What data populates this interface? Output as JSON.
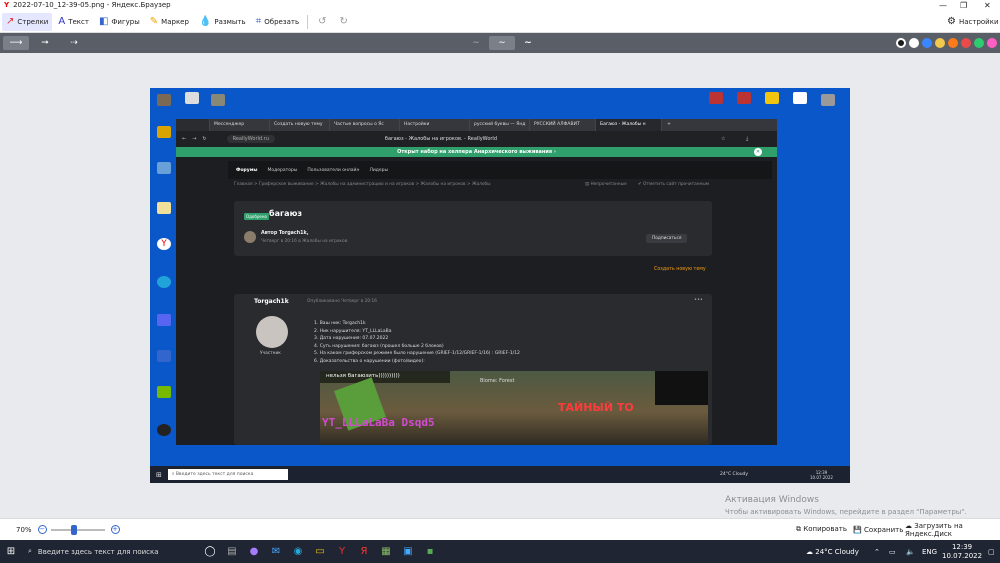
{
  "title": "2022-07-10_12-39-05.png - Яндекс.Браузер",
  "toolbar": {
    "arrows": "Стрелки",
    "text": "Текст",
    "shapes": "Фигуры",
    "marker": "Маркер",
    "blur": "Размыть",
    "crop": "Обрезать",
    "settings": "Настройки"
  },
  "zoom": "70%",
  "bottombar": {
    "copy": "Копировать",
    "save": "Сохранить",
    "upload": "Загрузить на Яндекс.Диск"
  },
  "taskbar": {
    "search": "Введите здесь текст для поиска",
    "weather": "24°C  Cloudy",
    "lang": "ENG",
    "time": "12:39",
    "date": "10.07.2022"
  },
  "watermark": {
    "title": "Активация Windows",
    "sub": "Чтобы активировать Windows, перейдите в раздел \"Параметры\"."
  },
  "colors": {
    "palette": [
      "#1b1b1b",
      "#ffffff",
      "#3a86ff",
      "#f2c94c",
      "#ff7a1a",
      "#e94b4b",
      "#2ecc71",
      "#ff5ec4"
    ]
  },
  "screenshot": {
    "tabs": [
      "Мессенджер",
      "Создать новую тему",
      "Частые вопросы о Яс",
      "Настройки",
      "русский буквы — Янд",
      "РУССКИЙ АЛФАВИТ",
      "Багаюз - Жалобы н"
    ],
    "url": "ReallyWorld.ru",
    "page_title": "багаюз - Жалобы на игроков. - ReallyWorld",
    "banner": "Открыт набор на хелпера Анархического выживания",
    "nav": [
      "Форумы",
      "Модераторы",
      "Пользователи онлайн",
      "Лидеры"
    ],
    "crumb": "Главная > Гриферское выживание > Жалобы на администрацию и на игроков > Жалобы на игроков > Жалобы",
    "unread": "Непрочитанные",
    "mark_read": "Отметить сайт прочитанным",
    "badge": "Одобрено",
    "thread_title": "багаюз",
    "author": "Автор Torgach1k,",
    "author_meta": "Четверг в 20:16 в Жалобы на игроков.",
    "subscribe": "Подписаться",
    "new_topic": "Создать новую тему",
    "poster": "Torgach1k",
    "posted": "Опубликовано Четверг в 20:16",
    "role": "Участник",
    "post_lines": [
      "1. Ваш ник: Torgach1k",
      "2. Ник нарушителя: YT_LLLaLaBa",
      "3. Дата нарушения: 07.07.2022",
      "4. Суть нарушения: багаюз (прошел больше 2 блоков)",
      "5. На каком гриферском режиме было нарушение (GRIEF-1/12/GRIEF-1/16) : GRIEF-1/12",
      "6. Доказательства о нарушении (фото/видео):"
    ],
    "game_chat": "нельзя багаюзить))))))))))",
    "game_biome": "Biome: Forest",
    "game_name": "YT_LLLaLaBa Dsqd5",
    "game_sign": "ТАЙНЫЙ ТО",
    "inner_time": "12:39",
    "inner_date": "10.07.2022",
    "inner_weather": "24°C Cloudy"
  }
}
